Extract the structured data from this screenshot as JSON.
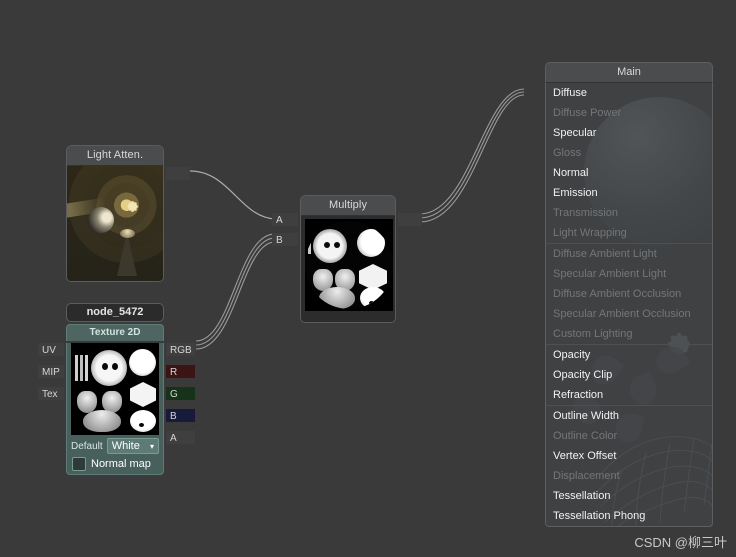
{
  "app": {
    "background_color": "#3a3a3a",
    "watermark": "CSDN @柳三叶"
  },
  "nodes": {
    "light_atten": {
      "title": "Light Atten.",
      "has_preview": true,
      "output_port": ""
    },
    "multiply": {
      "title": "Multiply",
      "inputs": [
        {
          "label": "A"
        },
        {
          "label": "B"
        }
      ],
      "output": ""
    },
    "texture2d": {
      "name": "node_5472",
      "title": "Texture 2D",
      "inputs": [
        {
          "label": "UV"
        },
        {
          "label": "MIP"
        },
        {
          "label": "Tex"
        }
      ],
      "outputs": [
        {
          "label": "RGB",
          "color": "#3f3f3f"
        },
        {
          "label": "R",
          "color": "#3c1414"
        },
        {
          "label": "G",
          "color": "#16331a"
        },
        {
          "label": "B",
          "color": "#181a3c"
        },
        {
          "label": "A",
          "color": "#3f3f3f"
        }
      ],
      "default_label": "Default",
      "default_value": "White",
      "default_caret": "▾",
      "normal_map_label": "Normal map",
      "normal_map_checked": false
    },
    "main": {
      "title": "Main",
      "properties": [
        {
          "label": "Diffuse",
          "enabled": true,
          "separator": false
        },
        {
          "label": "Diffuse Power",
          "enabled": false,
          "separator": false
        },
        {
          "label": "Specular",
          "enabled": true,
          "separator": false
        },
        {
          "label": "Gloss",
          "enabled": false,
          "separator": false
        },
        {
          "label": "Normal",
          "enabled": true,
          "separator": false
        },
        {
          "label": "Emission",
          "enabled": true,
          "separator": false
        },
        {
          "label": "Transmission",
          "enabled": false,
          "separator": false
        },
        {
          "label": "Light Wrapping",
          "enabled": false,
          "separator": false
        },
        {
          "label": "Diffuse Ambient Light",
          "enabled": false,
          "separator": true
        },
        {
          "label": "Specular Ambient Light",
          "enabled": false,
          "separator": false
        },
        {
          "label": "Diffuse Ambient Occlusion",
          "enabled": false,
          "separator": false
        },
        {
          "label": "Specular Ambient Occlusion",
          "enabled": false,
          "separator": false
        },
        {
          "label": "Custom Lighting",
          "enabled": false,
          "separator": false
        },
        {
          "label": "Opacity",
          "enabled": true,
          "separator": true
        },
        {
          "label": "Opacity Clip",
          "enabled": true,
          "separator": false
        },
        {
          "label": "Refraction",
          "enabled": true,
          "separator": false
        },
        {
          "label": "Outline Width",
          "enabled": true,
          "separator": true
        },
        {
          "label": "Outline Color",
          "enabled": false,
          "separator": false
        },
        {
          "label": "Vertex Offset",
          "enabled": true,
          "separator": false
        },
        {
          "label": "Displacement",
          "enabled": false,
          "separator": false
        },
        {
          "label": "Tessellation",
          "enabled": true,
          "separator": false
        },
        {
          "label": "Tessellation Phong",
          "enabled": true,
          "separator": false
        }
      ]
    }
  },
  "connections": [
    {
      "from": "light_atten.out",
      "to": "multiply.A",
      "strands": 1
    },
    {
      "from": "texture2d.RGB",
      "to": "multiply.B",
      "strands": 3
    },
    {
      "from": "multiply.out",
      "to": "main.Diffuse",
      "strands": 3
    }
  ]
}
